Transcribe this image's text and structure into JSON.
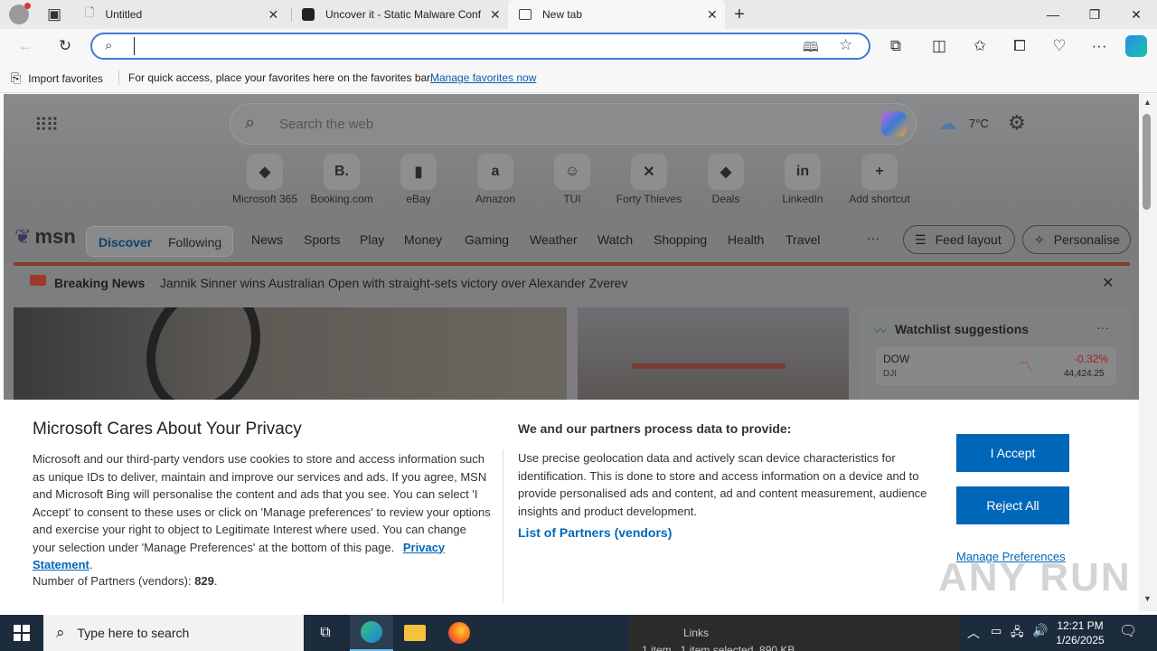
{
  "browser": {
    "tabs": [
      {
        "title": "Untitled",
        "active": false
      },
      {
        "title": "Uncover it - Static Malware Confi",
        "active": false
      },
      {
        "title": "New tab",
        "active": true
      }
    ],
    "address": {
      "value": "",
      "placeholder": ""
    },
    "favorites_bar": {
      "import_label": "Import favorites",
      "hint": "For quick access, place your favorites here on the favorites bar.",
      "manage_link": "Manage favorites now"
    }
  },
  "newtab": {
    "search_placeholder": "Search the web",
    "weather": "7°C",
    "shortcuts": [
      {
        "label": "Microsoft 365",
        "glyph": "◆"
      },
      {
        "label": "Booking.com",
        "glyph": "B."
      },
      {
        "label": "eBay",
        "glyph": "▮"
      },
      {
        "label": "Amazon",
        "glyph": "a"
      },
      {
        "label": "TUI",
        "glyph": "☺"
      },
      {
        "label": "Forty Thieves",
        "glyph": "✕"
      },
      {
        "label": "Deals",
        "glyph": "◆"
      },
      {
        "label": "LinkedIn",
        "glyph": "in"
      },
      {
        "label": "Add shortcut",
        "glyph": "+"
      }
    ],
    "brand": "msn",
    "feed_tabs": {
      "discover": "Discover",
      "following": "Following"
    },
    "nav": [
      "News",
      "Sports",
      "Play",
      "Money",
      "Gaming",
      "Weather",
      "Watch",
      "Shopping",
      "Health",
      "Travel"
    ],
    "more": "···",
    "feed_layout": "Feed layout",
    "personalise": "Personalise",
    "breaking": {
      "label": "Breaking News",
      "headline": "Jannik Sinner wins Australian Open with straight-sets victory over Alexander Zverev"
    },
    "watchlist": {
      "title": "Watchlist suggestions",
      "more": "···",
      "item": {
        "name": "DOW",
        "sub": "DJI",
        "change": "-0.32%",
        "value": "44,424.25"
      }
    }
  },
  "privacy": {
    "title": "Microsoft Cares About Your Privacy",
    "body": "Microsoft and our third-party vendors use cookies to store and access information such as unique IDs to deliver, maintain and improve our services and ads. If you agree, MSN and Microsoft Bing will personalise the content and ads that you see. You can select 'I Accept' to consent to these uses or click on 'Manage preferences' to review your options and exercise your right to object to Legitimate Interest where used.  You can change your selection under 'Manage Preferences' at the bottom of this page.",
    "privacy_link": "Privacy Statement",
    "partners_prefix": "Number of Partners (vendors):",
    "partners_count": "829",
    "right_title": "We and our partners process data to provide:",
    "right_body": "Use precise geolocation data and actively scan device characteristics for identification. This is done to store and access information on a device and to provide personalised ads and content, ad and content measurement, audience insights and product development.",
    "partners_link": "List of Partners (vendors)",
    "accept": "I Accept",
    "reject": "Reject All",
    "manage": "Manage Preferences"
  },
  "watermark": "ANY RUN",
  "taskbar": {
    "search_placeholder": "Type here to search",
    "background_window": {
      "links": "Links",
      "status": "1 item   1 item selected  890 KB"
    },
    "time": "12:21 PM",
    "date": "1/26/2025"
  }
}
